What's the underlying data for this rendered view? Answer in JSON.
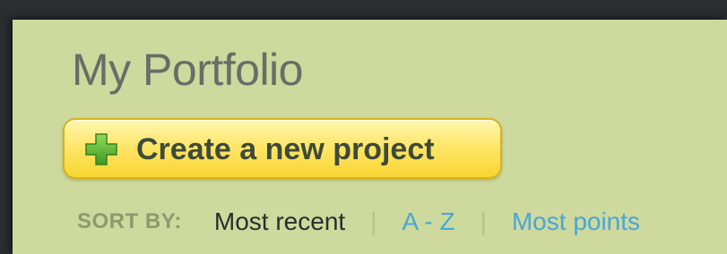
{
  "page": {
    "title": "My Portfolio"
  },
  "create_button": {
    "label": "Create a new project",
    "icon": "plus-icon"
  },
  "sort": {
    "label": "SORT BY:",
    "options": [
      {
        "label": "Most recent",
        "active": true
      },
      {
        "label": "A - Z",
        "active": false
      },
      {
        "label": "Most points",
        "active": false
      }
    ],
    "separator": "|"
  },
  "colors": {
    "panel_background": "#cdd99d",
    "button_fill": "#ffe66b",
    "link": "#4aa6d6",
    "title_text": "#6a6c66"
  }
}
